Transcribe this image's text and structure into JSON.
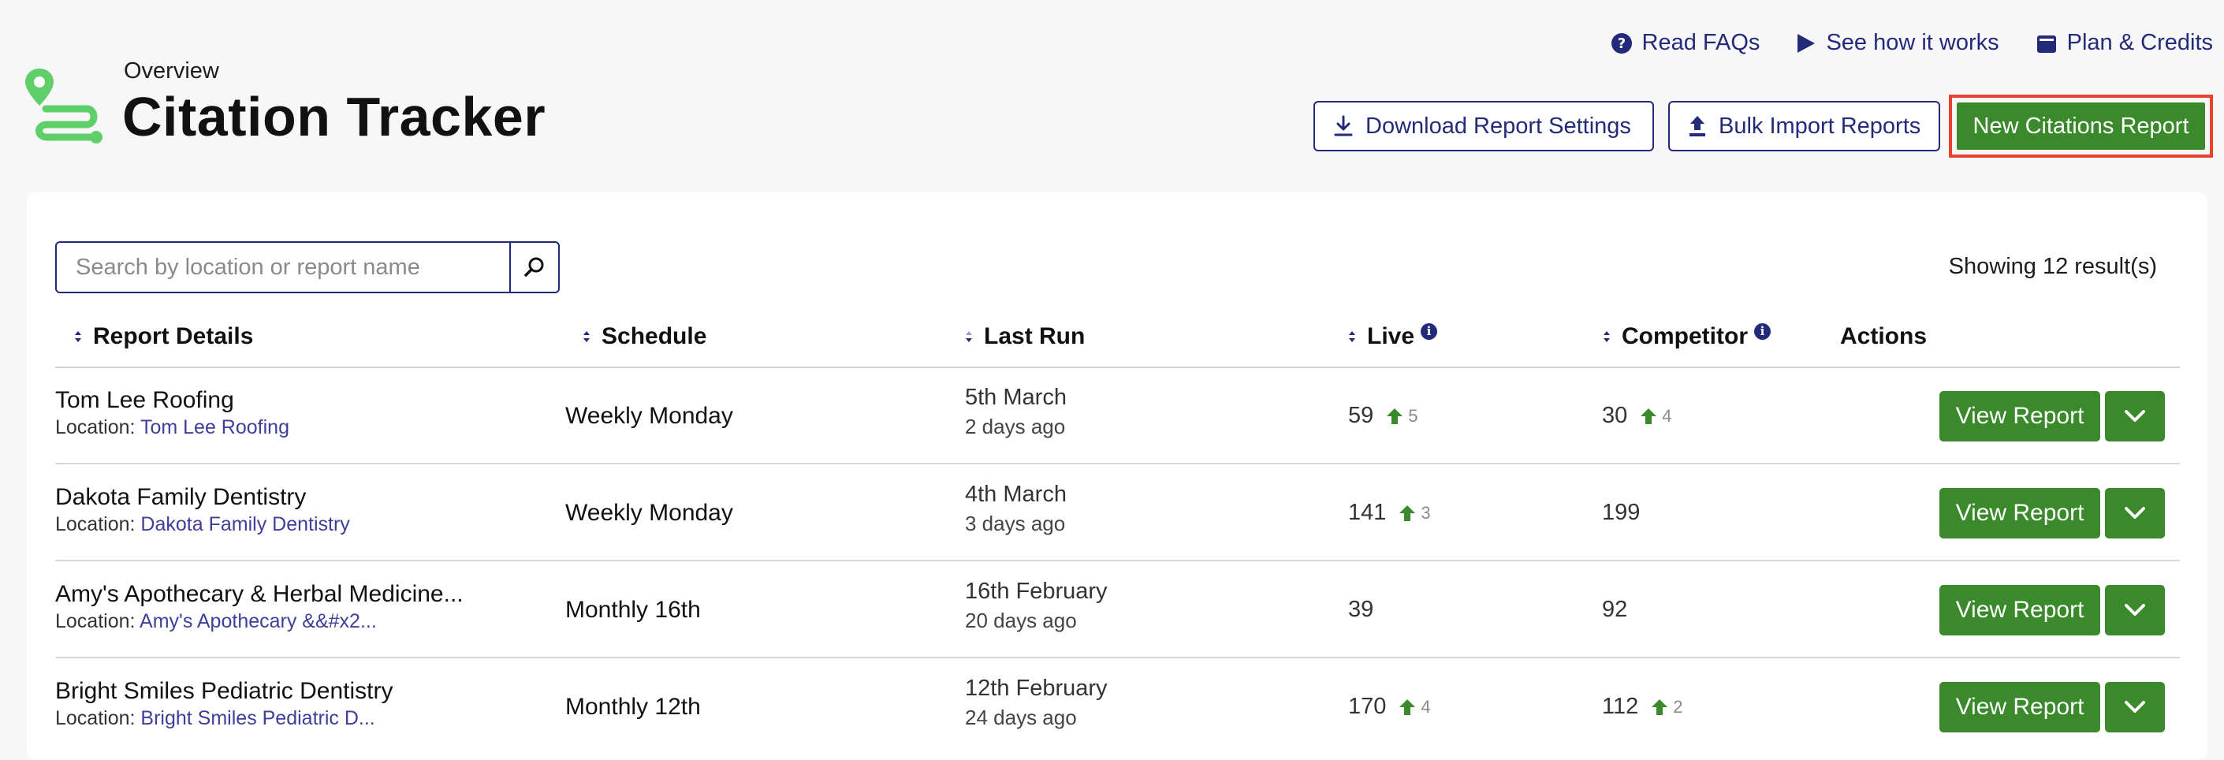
{
  "header": {
    "overview": "Overview",
    "title": "Citation Tracker"
  },
  "top_links": {
    "faqs": "Read FAQs",
    "how": "See how it works",
    "plan": "Plan & Credits"
  },
  "toolbar": {
    "download": "Download Report Settings",
    "bulk": "Bulk Import Reports",
    "new": "New Citations Report"
  },
  "search": {
    "placeholder": "Search by location or report name",
    "value": ""
  },
  "results": "Showing 12 result(s)",
  "columns": {
    "details": "Report Details",
    "schedule": "Schedule",
    "last_run": "Last Run",
    "live": "Live",
    "competitor": "Competitor",
    "actions": "Actions"
  },
  "location_label": "Location:",
  "view_label": "View Report",
  "rows": [
    {
      "name": "Tom Lee Roofing",
      "location": "Tom Lee Roofing",
      "schedule": "Weekly Monday",
      "date": "5th March",
      "ago": "2 days ago",
      "live": "59",
      "live_delta": "5",
      "comp": "30",
      "comp_delta": "4"
    },
    {
      "name": "Dakota Family Dentistry",
      "location": "Dakota Family Dentistry",
      "schedule": "Weekly Monday",
      "date": "4th March",
      "ago": "3 days ago",
      "live": "141",
      "live_delta": "3",
      "comp": "199",
      "comp_delta": ""
    },
    {
      "name": "Amy's Apothecary & Herbal Medicine...",
      "location": "Amy's Apothecary &&#x2...",
      "schedule": "Monthly 16th",
      "date": "16th February",
      "ago": "20 days ago",
      "live": "39",
      "live_delta": "",
      "comp": "92",
      "comp_delta": ""
    },
    {
      "name": "Bright Smiles Pediatric Dentistry",
      "location": "Bright Smiles Pediatric D...",
      "schedule": "Monthly 12th",
      "date": "12th February",
      "ago": "24 days ago",
      "live": "170",
      "live_delta": "4",
      "comp": "112",
      "comp_delta": "2"
    }
  ],
  "colors": {
    "brand_navy": "#232a7a",
    "action_green": "#3a8a2c",
    "highlight_red": "#e8442c",
    "logo_green": "#5fcf6a"
  }
}
